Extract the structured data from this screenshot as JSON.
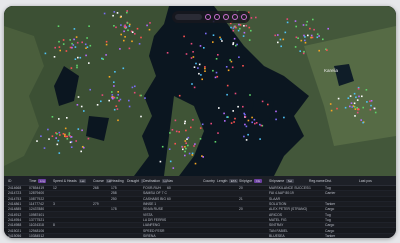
{
  "map": {
    "place_label": "Karelia"
  },
  "toolbar": {
    "icons": [
      "search-icon",
      "settings-icon",
      "clock-icon",
      "filter-icon",
      "user-icon",
      "info-icon"
    ]
  },
  "table": {
    "columns": [
      {
        "label": "ID",
        "chip": ""
      },
      {
        "label": "Time",
        "chip": "Lng"
      },
      {
        "label": "Speed & Heads",
        "chip": "Lat"
      },
      {
        "label": "Course",
        "chip": "Hd"
      },
      {
        "label": "Heading",
        "chip": ""
      },
      {
        "label": "Draught",
        "chip": "IMO"
      },
      {
        "label": "Destination",
        "chip": "Lng"
      },
      {
        "label": "Nav",
        "chip": ""
      },
      {
        "label": "Country",
        "chip": ""
      },
      {
        "label": "Length",
        "chip": "ETA"
      },
      {
        "label": "Shiptype",
        "chip": "Cls"
      },
      {
        "label": "Shipname",
        "chip": "Sel"
      },
      {
        "label": "Reg.name (vessel)",
        "chip": "Cnt"
      },
      {
        "label": "Dist.",
        "chip": ""
      },
      {
        "label": "Last pos",
        "chip": ""
      }
    ],
    "rows": [
      [
        "2414668",
        "07854419",
        "12",
        "268",
        "175",
        "",
        "FOXR-RUH",
        "60",
        "",
        "",
        "20",
        "MARSKILANCE SUCCESS",
        "1",
        "Tug",
        ""
      ],
      [
        "2414723",
        "12879400",
        "",
        "",
        "258",
        "",
        "SAMSU OF 7 CHI",
        "",
        "",
        "",
        "",
        "FAI 4 AAP 80:19",
        "",
        "Carrier",
        ""
      ],
      [
        "2414753",
        "10877922",
        "",
        "",
        "250",
        "",
        "CASHABS BIG FLIX",
        "60",
        "",
        "",
        "21",
        "SLAAR",
        "",
        "",
        ""
      ],
      [
        "2414861",
        "11477742",
        "3",
        "279",
        "",
        "",
        "INNSE 1",
        "",
        "",
        "",
        "",
        "SOLUTION",
        "",
        "Tanker",
        ""
      ],
      [
        "2414885",
        "12437880",
        "",
        "",
        "178",
        "",
        "SINVA RUSE",
        "",
        "",
        "",
        "20",
        "ALEX PETER (STRANG)",
        "",
        "Cargo",
        ""
      ],
      [
        "2414912",
        "10987401",
        "",
        "",
        "",
        "",
        "VISTA",
        "",
        "",
        "",
        "",
        "ARICOS",
        "",
        "Tug",
        ""
      ],
      [
        "2414954",
        "13777521",
        "",
        "",
        "",
        "",
        "LA DR FERRIS",
        "",
        "",
        "",
        "",
        "MATEL FIG",
        "",
        "Tug",
        ""
      ],
      [
        "2414988",
        "11024318",
        "8",
        "",
        "",
        "",
        "LIANFENG",
        "",
        "",
        "",
        "",
        "SINTRAY",
        "",
        "Cargo",
        ""
      ],
      [
        "2415021",
        "12948106",
        "",
        "",
        "",
        "",
        "SPEED FESR",
        "",
        "",
        "",
        "",
        "TAN FABIEL",
        "",
        "Cargo",
        ""
      ],
      [
        "2415056",
        "10384512",
        "",
        "",
        "",
        "",
        "SIRENA",
        "",
        "",
        "",
        "",
        "BLUESEA",
        "",
        "Tanker",
        ""
      ]
    ]
  }
}
